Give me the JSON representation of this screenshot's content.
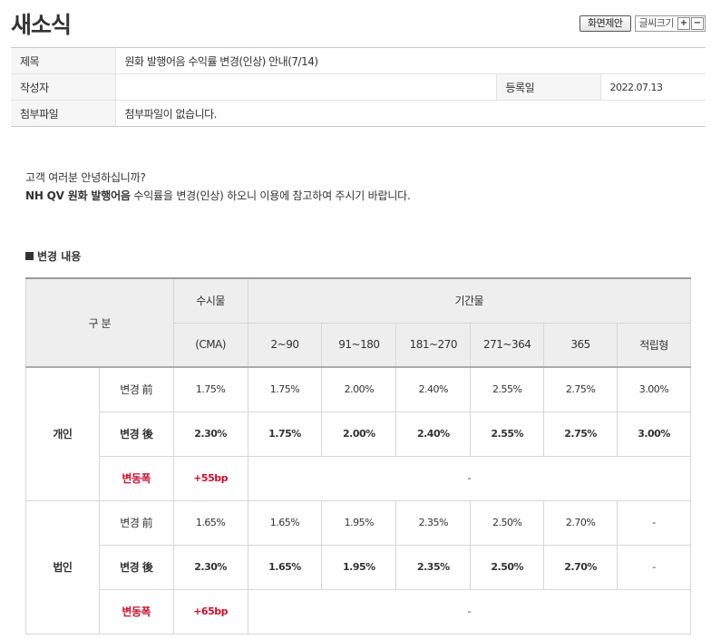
{
  "page": {
    "title": "새소식",
    "suggest_button": "화면제안",
    "font_size_label": "글씨크기",
    "font_plus": "+",
    "font_minus": "−"
  },
  "meta": {
    "subject_label": "제목",
    "subject_value": "원화 발행어음 수익률 변경(인상) 안내(7/14)",
    "author_label": "작성자",
    "author_value": "",
    "date_label": "등록일",
    "date_value": "2022.07.13",
    "attach_label": "첨부파일",
    "attach_value": "첨부파일이 없습니다."
  },
  "body": {
    "line1": "고객 여러분 안녕하십니까?",
    "line2_bold": "NH QV 원화 발행어음",
    "line2_rest": " 수익률을 변경(인상) 하오니 이용에 참고하여 주시기 바랍니다.",
    "section_title": "변경 내용"
  },
  "table": {
    "header_group": "구 분",
    "header_demand": "수시물",
    "header_term": "기간물",
    "columns": [
      "(CMA)",
      "2~90",
      "91~180",
      "181~270",
      "271~364",
      "365",
      "적립형"
    ],
    "groups": [
      {
        "name": "개인",
        "before_label": "변경 前",
        "before": [
          "1.75%",
          "1.75%",
          "2.00%",
          "2.40%",
          "2.55%",
          "2.75%",
          "3.00%"
        ],
        "after_label": "변경 後",
        "after": [
          "2.30%",
          "1.75%",
          "2.00%",
          "2.40%",
          "2.55%",
          "2.75%",
          "3.00%"
        ],
        "change_label": "변동폭",
        "change_value": "+55bp",
        "change_rest": "-"
      },
      {
        "name": "법인",
        "before_label": "변경 前",
        "before": [
          "1.65%",
          "1.65%",
          "1.95%",
          "2.35%",
          "2.50%",
          "2.70%",
          "-"
        ],
        "after_label": "변경 後",
        "after": [
          "2.30%",
          "1.65%",
          "1.95%",
          "2.35%",
          "2.50%",
          "2.70%",
          "-"
        ],
        "change_label": "변동폭",
        "change_value": "+65bp",
        "change_rest": "-"
      }
    ]
  }
}
